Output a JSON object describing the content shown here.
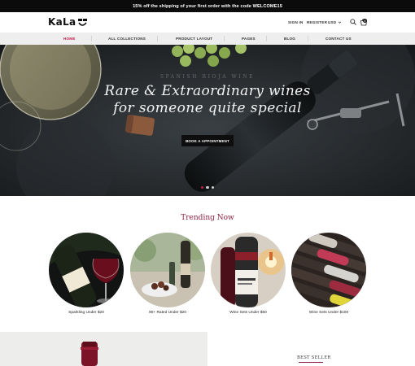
{
  "promo": {
    "text": "15% off the shipping of your first order with the code WELCOME15"
  },
  "header": {
    "logo_text": "KaLa",
    "sign_in": "SIGN IN",
    "register": "REGISTER",
    "currency": "USD",
    "cart_count": "0"
  },
  "nav": {
    "items": [
      {
        "label": "HOME",
        "active": true
      },
      {
        "label": "ALL COLLECTIONS"
      },
      {
        "label": "PRODUCT LAYOUT"
      },
      {
        "label": "PAGES"
      },
      {
        "label": "BLOG"
      },
      {
        "label": "CONTACT US"
      }
    ]
  },
  "hero": {
    "kicker": "SPANISH RIOJA WINE",
    "title_line1": "Rare & Extraordinary wines",
    "title_line2": "for someone quite special",
    "button": "BOOK A APPOINTMENT",
    "slides": 3,
    "active_slide": 1
  },
  "trending": {
    "title": "Trending Now",
    "collections": [
      {
        "label": "Sparkling Under $20"
      },
      {
        "label": "90+ Rated Under $20"
      },
      {
        "label": "Wine Sets Under $50"
      },
      {
        "label": "Wine Sets Under $100"
      }
    ]
  },
  "best_seller": {
    "heading": "BEST SELLER"
  },
  "colors": {
    "accent": "#c21c4a",
    "heading": "#8e1f3e",
    "top_bar": "#0b0b0b",
    "nav_bg": "#eeeeee"
  }
}
